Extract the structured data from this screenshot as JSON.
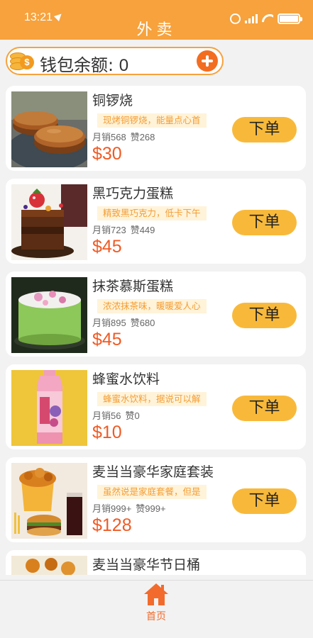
{
  "status_bar": {
    "time": "13:21"
  },
  "header": {
    "title": "外卖"
  },
  "wallet": {
    "label": "钱包余额: ",
    "balance": "0",
    "coin_symbol": "$"
  },
  "products": [
    {
      "name": "铜锣烧",
      "desc": "现烤铜锣烧，能量点心首",
      "sales": "月销568",
      "likes": "赞268",
      "price": "$30",
      "button": "下单",
      "image_icon": "dorayaki-image"
    },
    {
      "name": "黑巧克力蛋糕",
      "desc": "精致黑巧克力，低卡下午",
      "sales": "月销723",
      "likes": "赞449",
      "price": "$45",
      "button": "下单",
      "image_icon": "chocolate-cake-image"
    },
    {
      "name": "抹茶慕斯蛋糕",
      "desc": "浓浓抹茶味，暖暖爱人心",
      "sales": "月销895",
      "likes": "赞680",
      "price": "$45",
      "button": "下单",
      "image_icon": "matcha-mousse-image"
    },
    {
      "name": "蜂蜜水饮料",
      "desc": "蜂蜜水饮料，据说可以解",
      "sales": "月销56",
      "likes": "赞0",
      "price": "$10",
      "button": "下单",
      "image_icon": "honey-drink-image"
    },
    {
      "name": "麦当当豪华家庭套装",
      "desc": "虽然说是家庭套餐，但是",
      "sales": "月销999+",
      "likes": "赞999+",
      "price": "$128",
      "button": "下单",
      "image_icon": "family-meal-image"
    },
    {
      "name": "麦当当豪华节日桶",
      "image_icon": "holiday-bucket-image"
    }
  ],
  "tabbar": {
    "home_label": "首页"
  },
  "colors": {
    "accent": "#f7a23c",
    "price": "#f05a24",
    "button": "#f8b93a",
    "tab_active": "#f26b2c"
  }
}
